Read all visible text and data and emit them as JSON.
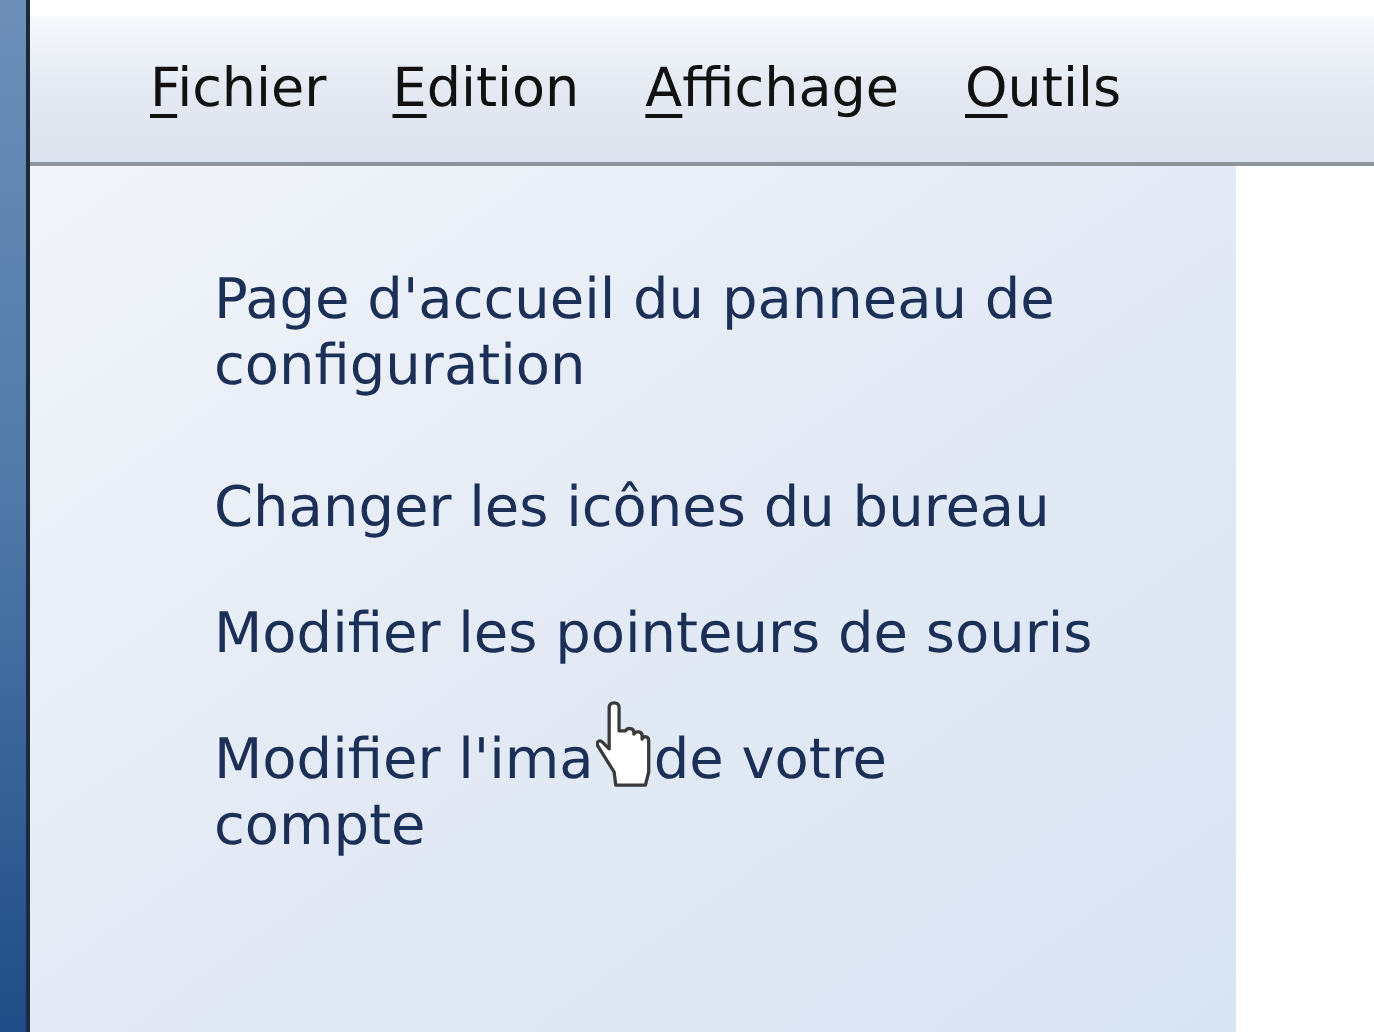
{
  "menu_bar": [
    {
      "accel": "F",
      "rest": "ichier"
    },
    {
      "accel": "E",
      "rest": "dition"
    },
    {
      "accel": "A",
      "rest": "ffichage"
    },
    {
      "accel": "O",
      "rest": "utils"
    }
  ],
  "task_links": [
    {
      "kind": "link",
      "text": "Page d'accueil du panneau de configuration"
    },
    {
      "kind": "link",
      "text": "Changer les icônes du bureau"
    },
    {
      "kind": "link",
      "text": "Modifier les pointeurs de souris"
    },
    {
      "kind": "covered_link",
      "before_cursor": "Modifier l'ima",
      "after_cursor": "de votre compte"
    }
  ]
}
